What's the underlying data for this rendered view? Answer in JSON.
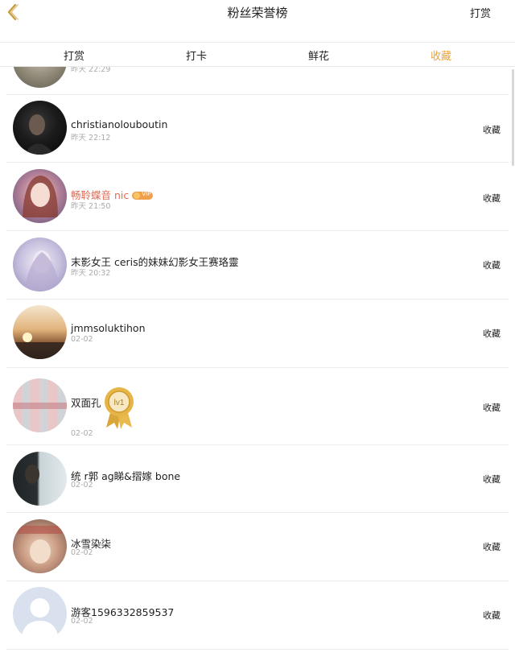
{
  "header": {
    "title": "粉丝荣誉榜",
    "right_action": "打赏"
  },
  "tabs": [
    {
      "label": "打赏",
      "active": false
    },
    {
      "label": "打卡",
      "active": false
    },
    {
      "label": "鲜花",
      "active": false
    },
    {
      "label": "收藏",
      "active": true
    }
  ],
  "partial_row": {
    "time": "昨天 22:29"
  },
  "rows": [
    {
      "name": "christianolouboutin",
      "time": "昨天 22:12",
      "action": "收藏"
    },
    {
      "name": "畅聆蝶音 nic",
      "time": "昨天 21:50",
      "action": "收藏",
      "vip": true,
      "vip_label": "VIP"
    },
    {
      "name": "末影女王 ceris的妹妹幻影女王赛珞靈",
      "time": "昨天 20:32",
      "action": "收藏"
    },
    {
      "name": "jmmsoluktihon",
      "time": "02-02",
      "action": "收藏"
    },
    {
      "name": "双面孔",
      "time": "02-02",
      "action": "收藏",
      "medal_label": "lv1"
    },
    {
      "name": "统 r郭 ag睇&摺嫁 bone",
      "time": "02-02",
      "action": "收藏"
    },
    {
      "name": "冰雪染柒",
      "time": "02-02",
      "action": "收藏"
    },
    {
      "name": "游客1596332859537",
      "time": "02-02",
      "action": "收藏"
    }
  ],
  "colors": {
    "accent": "#e8a43a",
    "vip_name": "#e06b55"
  }
}
